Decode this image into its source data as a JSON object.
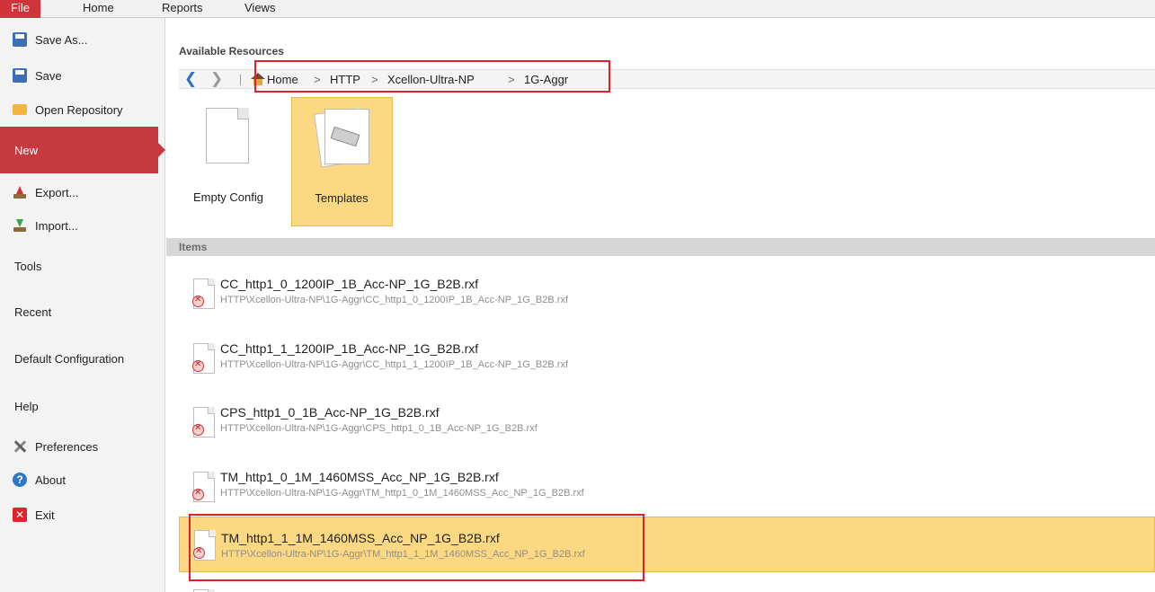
{
  "menu": {
    "file": "File",
    "home": "Home",
    "reports": "Reports",
    "views": "Views"
  },
  "nav": {
    "save_as": "Save As...",
    "save": "Save",
    "open_repository": "Open Repository",
    "new": "New",
    "export": "Export...",
    "import": "Import...",
    "tools": "Tools",
    "recent": "Recent",
    "default_configuration": "Default Configuration",
    "help": "Help",
    "preferences": "Preferences",
    "about": "About",
    "exit": "Exit"
  },
  "main": {
    "available_resources": "Available Resources",
    "breadcrumb": [
      "Home",
      "HTTP",
      "Xcellon-Ultra-NP",
      "1G-Aggr"
    ],
    "breadcrumb_sep": ">",
    "tiles": {
      "empty_config": "Empty Config",
      "templates": "Templates"
    },
    "items_header": "Items",
    "items": [
      {
        "name": "CC_http1_0_1200IP_1B_Acc-NP_1G_B2B.rxf",
        "path": "HTTP\\Xcellon-Ultra-NP\\1G-Aggr\\CC_http1_0_1200IP_1B_Acc-NP_1G_B2B.rxf"
      },
      {
        "name": "CC_http1_1_1200IP_1B_Acc-NP_1G_B2B.rxf",
        "path": "HTTP\\Xcellon-Ultra-NP\\1G-Aggr\\CC_http1_1_1200IP_1B_Acc-NP_1G_B2B.rxf"
      },
      {
        "name": "CPS_http1_0_1B_Acc-NP_1G_B2B.rxf",
        "path": "HTTP\\Xcellon-Ultra-NP\\1G-Aggr\\CPS_http1_0_1B_Acc-NP_1G_B2B.rxf"
      },
      {
        "name": "TM_http1_0_1M_1460MSS_Acc_NP_1G_B2B.rxf",
        "path": "HTTP\\Xcellon-Ultra-NP\\1G-Aggr\\TM_http1_0_1M_1460MSS_Acc_NP_1G_B2B.rxf"
      },
      {
        "name": "TM_http1_1_1M_1460MSS_Acc_NP_1G_B2B.rxf",
        "path": "HTTP\\Xcellon-Ultra-NP\\1G-Aggr\\TM_http1_1_1M_1460MSS_Acc_NP_1G_B2B.rxf"
      }
    ]
  },
  "colors": {
    "accent": "#c6393e",
    "selection": "#fcd882",
    "highlight_box": "#e0202a"
  }
}
